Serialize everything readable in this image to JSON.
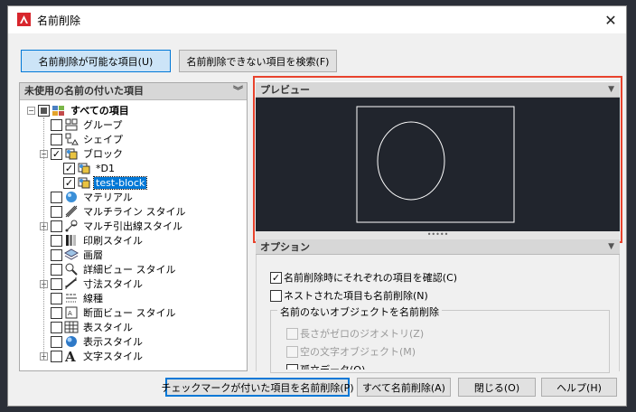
{
  "window": {
    "title": "名前削除",
    "close_glyph": "✕"
  },
  "tabs": [
    {
      "label": "名前削除が可能な項目(U)",
      "active": true
    },
    {
      "label": "名前削除できない項目を検索(F)",
      "active": false
    }
  ],
  "tree_panel": {
    "header": "未使用の名前の付いた項目",
    "items": [
      {
        "label": "すべての項目",
        "level": 0,
        "expander": "−",
        "check": "partial",
        "icon": "all-items-icon",
        "bold": true
      },
      {
        "label": "グループ",
        "level": 1,
        "expander": "",
        "check": "none",
        "icon": "group-icon"
      },
      {
        "label": "シェイプ",
        "level": 1,
        "expander": "",
        "check": "none",
        "icon": "shape-icon"
      },
      {
        "label": "ブロック",
        "level": 1,
        "expander": "−",
        "check": "checked",
        "icon": "block-icon"
      },
      {
        "label": "*D1",
        "level": 2,
        "expander": "",
        "check": "checked",
        "icon": "block-icon"
      },
      {
        "label": "test-block",
        "level": 2,
        "expander": "",
        "check": "checked",
        "icon": "block-icon",
        "selected": true
      },
      {
        "label": "マテリアル",
        "level": 1,
        "expander": "",
        "check": "none",
        "icon": "material-icon"
      },
      {
        "label": "マルチライン スタイル",
        "level": 1,
        "expander": "",
        "check": "none",
        "icon": "multiline-style-icon"
      },
      {
        "label": "マルチ引出線スタイル",
        "level": 1,
        "expander": "+",
        "check": "none",
        "icon": "multileader-style-icon"
      },
      {
        "label": "印刷スタイル",
        "level": 1,
        "expander": "",
        "check": "none",
        "icon": "plot-style-icon"
      },
      {
        "label": "画層",
        "level": 1,
        "expander": "",
        "check": "none",
        "icon": "layer-icon"
      },
      {
        "label": "詳細ビュー スタイル",
        "level": 1,
        "expander": "",
        "check": "none",
        "icon": "detail-view-style-icon"
      },
      {
        "label": "寸法スタイル",
        "level": 1,
        "expander": "+",
        "check": "none",
        "icon": "dimension-style-icon"
      },
      {
        "label": "線種",
        "level": 1,
        "expander": "",
        "check": "none",
        "icon": "linetype-icon"
      },
      {
        "label": "断面ビュー スタイル",
        "level": 1,
        "expander": "",
        "check": "none",
        "icon": "section-view-style-icon"
      },
      {
        "label": "表スタイル",
        "level": 1,
        "expander": "",
        "check": "none",
        "icon": "table-style-icon"
      },
      {
        "label": "表示スタイル",
        "level": 1,
        "expander": "",
        "check": "none",
        "icon": "visual-style-icon"
      },
      {
        "label": "文字スタイル",
        "level": 1,
        "expander": "+",
        "check": "none",
        "icon": "text-style-icon"
      }
    ]
  },
  "preview": {
    "header": "プレビュー",
    "grip": "•••••"
  },
  "options": {
    "header": "オプション",
    "confirm_each": {
      "label": "名前削除時にそれぞれの項目を確認(C)",
      "checked": true
    },
    "nested": {
      "label": "ネストされた項目も名前削除(N)",
      "checked": false
    },
    "unnamed_group": {
      "title": "名前のないオブジェクトを名前削除",
      "zero_length": "長さがゼロのジオメトリ(Z)",
      "empty_text": "空の文字オブジェクト(M)",
      "partial_cut": "孤立データ(O)"
    }
  },
  "buttons": {
    "purge_checked": "チェックマークが付いた項目を名前削除(P)",
    "purge_all": "すべて名前削除(A)",
    "close": "閉じる(O)",
    "help": "ヘルプ(H)"
  },
  "colors": {
    "accent": "#0078d7",
    "highlight_frame": "#e8432d",
    "canvas": "#21252d"
  }
}
